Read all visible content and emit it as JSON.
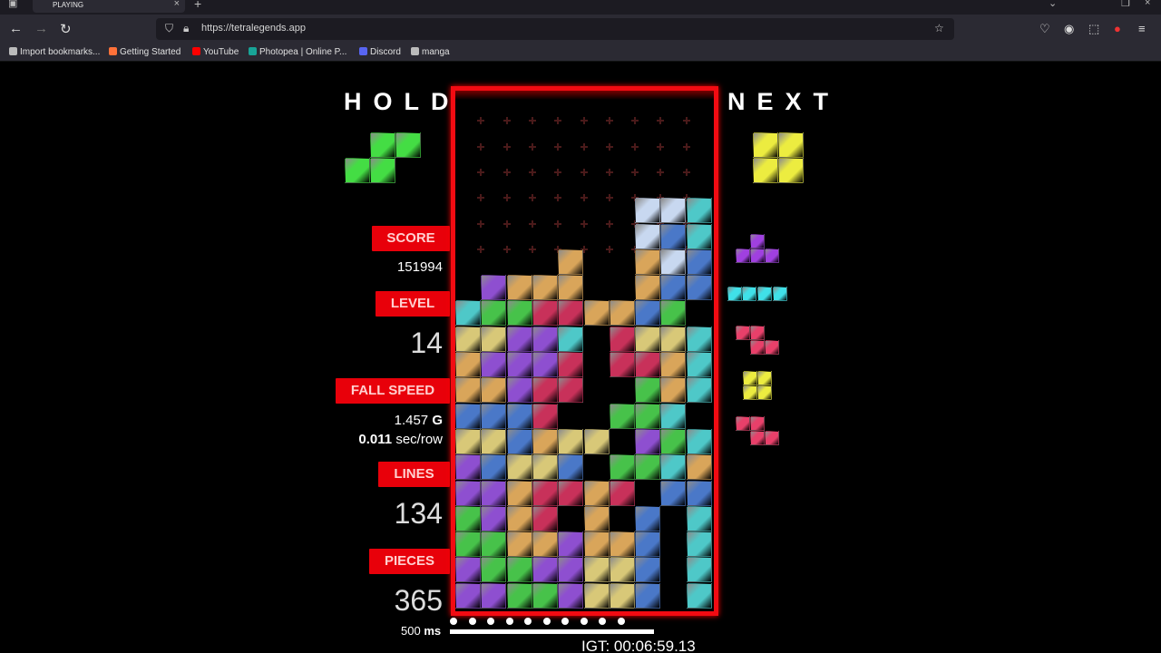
{
  "browser": {
    "tab_title": "PLAYING",
    "url": "https://tetralegends.app",
    "bookmarks": [
      {
        "label": "Import bookmarks...",
        "color": "#bbbbbb"
      },
      {
        "label": "Getting Started",
        "color": "#ff7139"
      },
      {
        "label": "YouTube",
        "color": "#ff0000"
      },
      {
        "label": "Photopea | Online P...",
        "color": "#18a497"
      },
      {
        "label": "Discord",
        "color": "#5865f2"
      },
      {
        "label": "manga",
        "color": "#bbbbbb"
      }
    ]
  },
  "game": {
    "hold_title": "HOLD",
    "next_title": "NEXT",
    "hold_piece": "S",
    "next_queue": [
      "O",
      "T",
      "I",
      "Z",
      "O",
      "Z"
    ],
    "stats": {
      "score_label": "SCORE",
      "score": "151994",
      "level_label": "LEVEL",
      "level": "14",
      "fall_speed_label": "FALL SPEED",
      "fall_speed_g": "1.457",
      "fall_speed_g_unit": "G",
      "fall_speed_sec": "0.011",
      "fall_speed_sec_unit": "sec/row",
      "lines_label": "LINES",
      "lines": "134",
      "pieces_label": "PIECES",
      "pieces": "365"
    },
    "lock_delay_value": "500",
    "lock_delay_unit": "ms",
    "lock_delay_dots": 10,
    "igt": "IGT: 00:06:59.13",
    "colors": {
      "Y": "#d8c878",
      "O": "#d9a55a",
      "P": "#8e4fd0",
      "C": "#4ec8c8",
      "G": "#47c24a",
      "R": "#c8315a",
      "B": "#4a78c8",
      "W": "#c8d8f0",
      "S": "#44dd44",
      "Q": "#ecec40",
      "T": "#a040e0",
      "I": "#40e0e8",
      "Z": "#e8406a",
      "board_border": "#f20b12",
      "label_bg": "#e8000a"
    },
    "board_rows": [
      "..........",
      "..........",
      "..........",
      "..........",
      "...........",
      "..........",
      "..........",
      "..........",
      "..........",
      "..........",
      "..........",
      "..........",
      "..........",
      "..........",
      "..........",
      "..........",
      "..........",
      "..........",
      "..........",
      "..........",
      "..........",
      "..........",
      "..........",
      "..........",
      ".......WWC",
      ".......WBC",
      "....O..OWBC",
      ".POOO..OBBC",
      "CGGRROOBG.",
      "YYPPC.RYYC",
      "OPPPR.RROC",
      "OOPRR..GOC",
      "BBBR..GGC",
      "YYBOYY.PGC",
      "PBYYB.GGCO",
      "PPORROR.BB",
      "GPOR.O.B.C",
      "GGOOPOOB.C",
      "PGGPPYYB.C",
      "PPGGPYYB.C"
    ]
  }
}
